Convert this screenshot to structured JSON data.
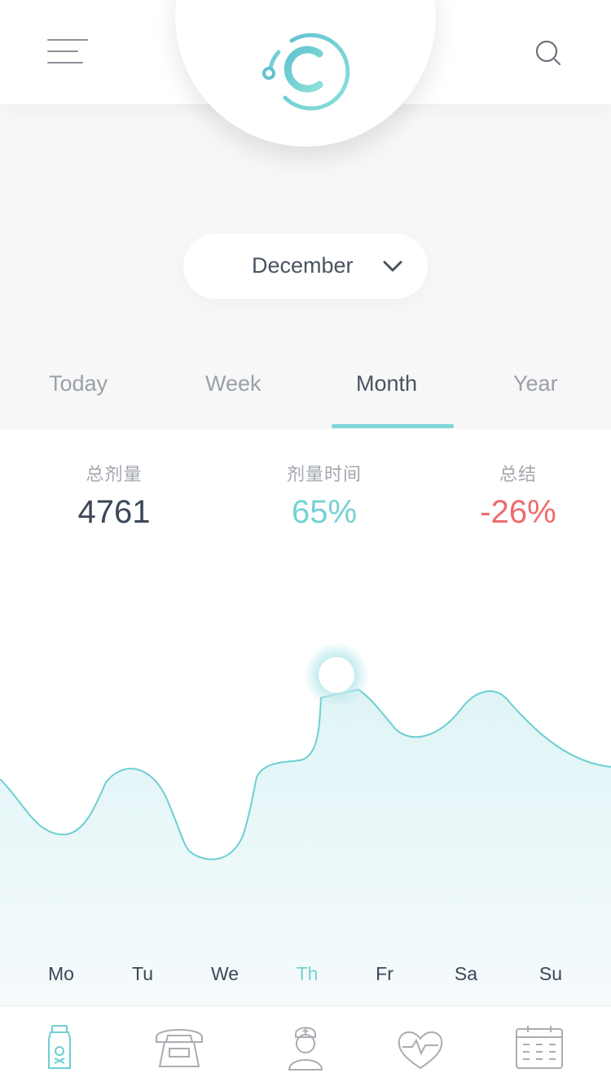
{
  "header": {
    "menu_icon": "hamburger-menu-icon",
    "logo_icon": "c-orbit-logo-icon",
    "search_icon": "search-icon"
  },
  "month_selector": {
    "value": "December",
    "icon": "chevron-down-icon"
  },
  "tabs": [
    {
      "label": "Today",
      "active": false
    },
    {
      "label": "Week",
      "active": false
    },
    {
      "label": "Month",
      "active": true
    },
    {
      "label": "Year",
      "active": false
    }
  ],
  "stats": [
    {
      "label": "总剂量",
      "value": "4761",
      "color": "#3c4757"
    },
    {
      "label": "剂量时间",
      "value": "65%",
      "color": "#74d1d3"
    },
    {
      "label": "总结",
      "value": "-26%",
      "color": "#ef6b6b"
    }
  ],
  "chart_data": {
    "type": "area",
    "categories": [
      "Mo",
      "Tu",
      "We",
      "Th",
      "Fr",
      "Sa",
      "Su"
    ],
    "highlighted": "Th",
    "line_color": "#6ccfd2",
    "fill_color": "#e8f7f8",
    "grid": false
  },
  "bottom_nav": [
    {
      "icon": "medicine-bottle-icon",
      "active": true
    },
    {
      "icon": "telephone-icon",
      "active": false
    },
    {
      "icon": "nurse-icon",
      "active": false
    },
    {
      "icon": "heart-pulse-icon",
      "active": false
    },
    {
      "icon": "calendar-icon",
      "active": false
    }
  ],
  "colors": {
    "accent": "#74d1d3",
    "negative": "#ef6b6b",
    "text_dark": "#3c4757",
    "text_muted": "#9aa0a8"
  }
}
